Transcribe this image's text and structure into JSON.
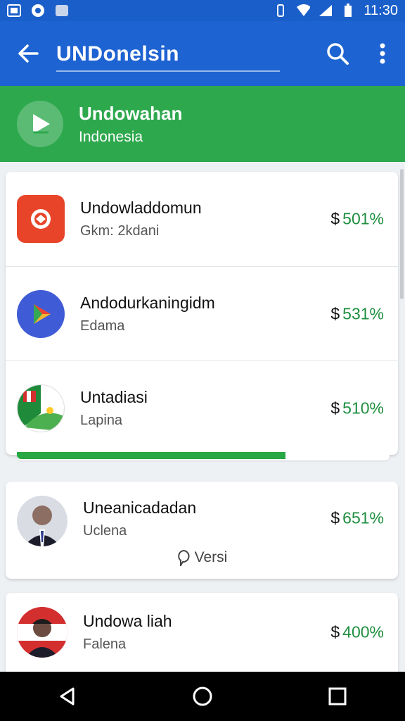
{
  "status_bar": {
    "time": "11:30"
  },
  "toolbar": {
    "title": "UNDonelsin"
  },
  "banner": {
    "title": "Undowahan",
    "subtitle": "Indonesia"
  },
  "list_card": {
    "rows": [
      {
        "title": "Undowladdomun",
        "subtitle": "Gkm: 2kdani",
        "currency": "$",
        "value": "501%"
      },
      {
        "title": "Andodurkaningidm",
        "subtitle": "Edama",
        "currency": "$",
        "value": "531%"
      },
      {
        "title": "Untadiasi",
        "subtitle": "Lapina",
        "currency": "$",
        "value": "510%"
      }
    ],
    "progress": 0.72
  },
  "card2": {
    "title": "Uneanicadadan",
    "subtitle": "Uclena",
    "currency": "$",
    "value": "651%",
    "versi_label": "Versi"
  },
  "card3": {
    "title": "Undowa liah",
    "subtitle": "Falena",
    "currency": "$",
    "value": "400%"
  },
  "colors": {
    "primary": "#1e63d2",
    "banner": "#2ea84d",
    "accent_green": "#1e8e3e"
  }
}
